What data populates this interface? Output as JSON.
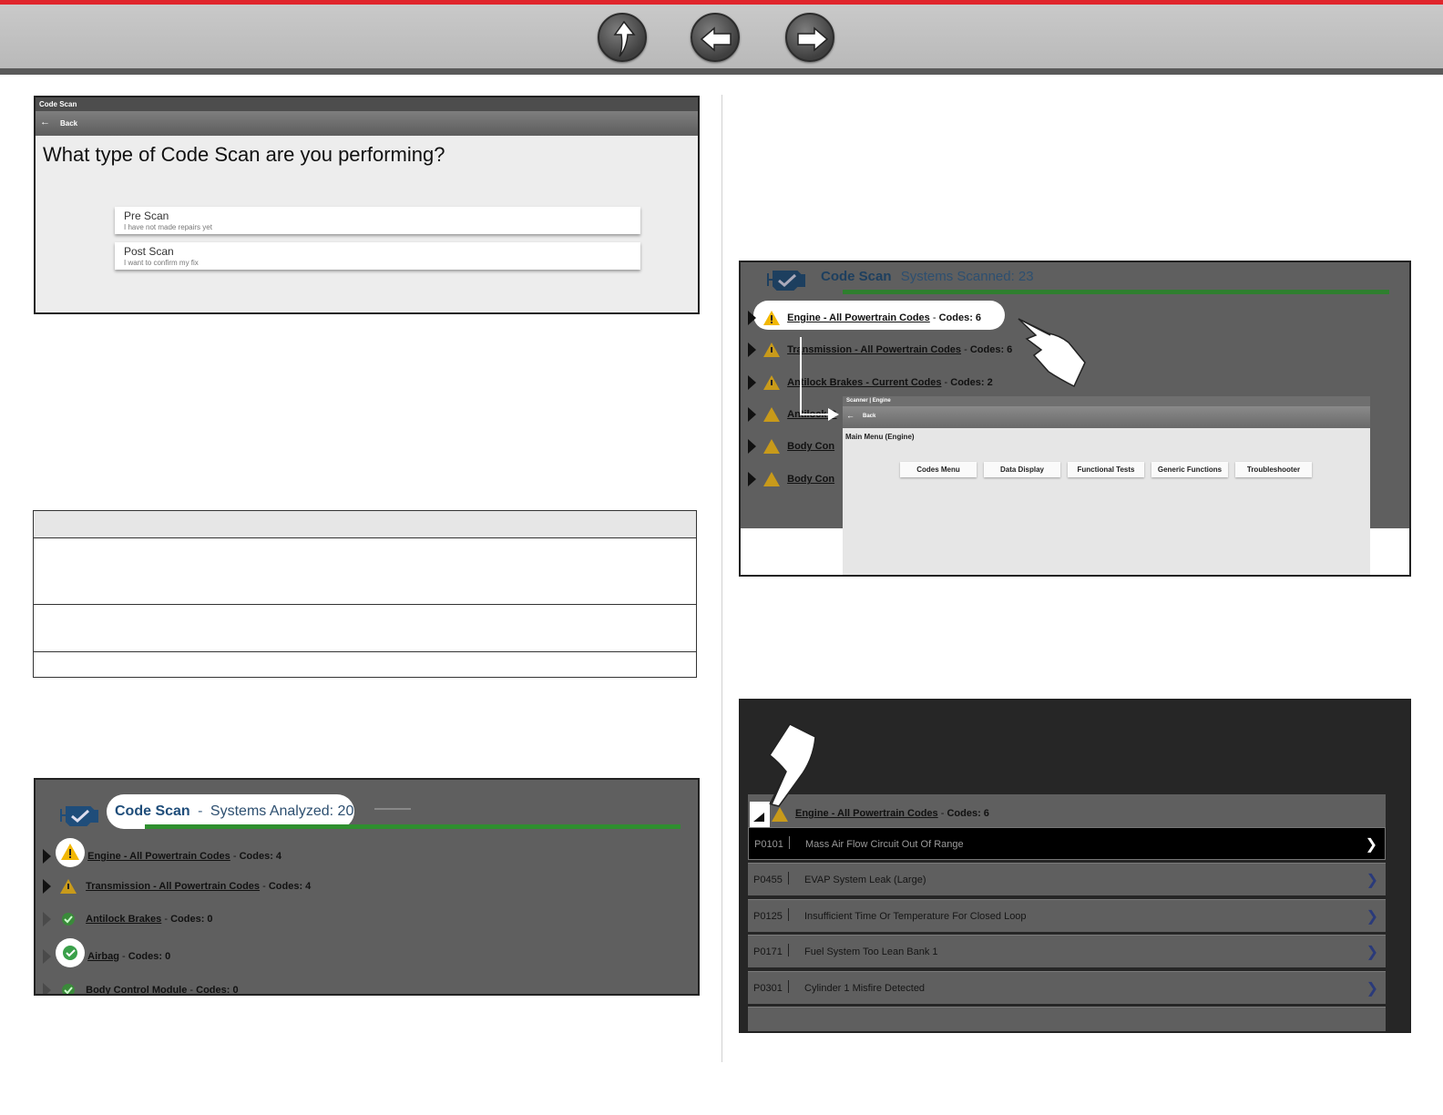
{
  "nav": {
    "up_icon": "up-arrow-icon",
    "back_icon": "left-arrow-icon",
    "forward_icon": "right-arrow-icon"
  },
  "shot1": {
    "title": "Code Scan",
    "back": "Back",
    "question": "What type of Code Scan are you performing?",
    "options": [
      {
        "title": "Pre Scan",
        "subtitle": "I have not made repairs yet"
      },
      {
        "title": "Post Scan",
        "subtitle": "I want to confirm my fix"
      }
    ]
  },
  "shot2": {
    "title": "Code Scan",
    "separator": "-",
    "subtitle": "Systems Analyzed: 20",
    "rows": [
      {
        "name": "Engine - All Powertrain Codes",
        "codes": "Codes: 4",
        "status": "warning"
      },
      {
        "name": "Transmission - All Powertrain Codes",
        "codes": "Codes: 4",
        "status": "warning"
      },
      {
        "name": "Antilock Brakes",
        "codes": "Codes: 0",
        "status": "ok"
      },
      {
        "name": "Airbag",
        "codes": "Codes: 0",
        "status": "ok"
      },
      {
        "name": "Body Control Module",
        "codes": "Codes: 0",
        "status": "ok"
      }
    ]
  },
  "shot3": {
    "title": "Code Scan",
    "subtitle": "Systems Scanned: 23",
    "rows": [
      {
        "name": "Engine - All Powertrain Codes",
        "codes": "Codes: 6"
      },
      {
        "name": "Transmission - All Powertrain Codes",
        "codes": "Codes: 6"
      },
      {
        "name": "Antilock Brakes - Current Codes",
        "codes": "Codes: 2"
      },
      {
        "name": "Antilock B",
        "codes": ""
      },
      {
        "name": "Body Con",
        "codes": ""
      },
      {
        "name": "Body Con",
        "codes": ""
      }
    ],
    "inner": {
      "title": "Scanner | Engine",
      "back": "Back",
      "heading": "Main Menu (Engine)",
      "buttons": [
        "Codes Menu",
        "Data Display",
        "Functional Tests",
        "Generic Functions",
        "Troubleshooter"
      ]
    }
  },
  "shot4": {
    "header": {
      "name": "Engine - All Powertrain Codes",
      "codes": "Codes: 6"
    },
    "codes": [
      {
        "code": "P0101",
        "desc": "Mass Air Flow Circuit Out Of Range",
        "selected": true
      },
      {
        "code": "P0455",
        "desc": "EVAP System Leak (Large)"
      },
      {
        "code": "P0125",
        "desc": "Insufficient Time Or Temperature For Closed Loop"
      },
      {
        "code": "P0171",
        "desc": "Fuel System Too Lean Bank 1"
      },
      {
        "code": "P0301",
        "desc": "Cylinder 1 Misfire Detected"
      }
    ]
  },
  "colors": {
    "accent_red": "#e0252c",
    "warning": "#f2b705",
    "ok": "#3aa04a",
    "progress": "#2f8f2f"
  }
}
